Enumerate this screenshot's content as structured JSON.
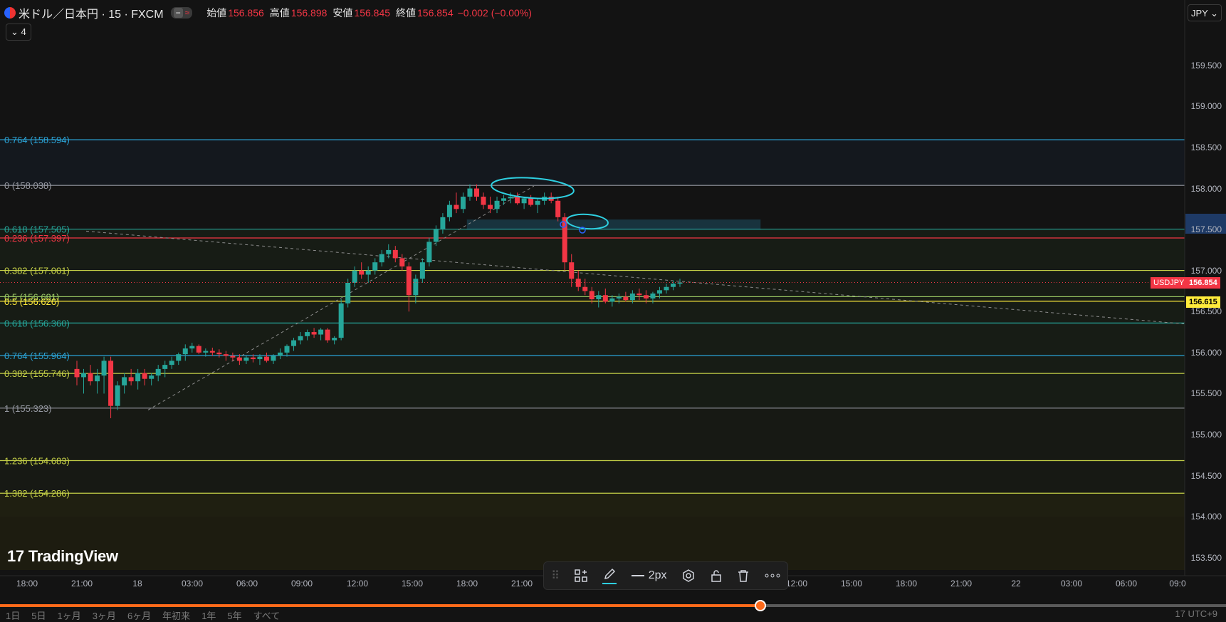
{
  "header": {
    "title": "米ドル／日本円 · 15 · FXCM",
    "ohlc": [
      {
        "label": "始値",
        "value": "156.856"
      },
      {
        "label": "高値",
        "value": "156.898"
      },
      {
        "label": "安値",
        "value": "156.845"
      },
      {
        "label": "終値",
        "value": "156.854"
      },
      {
        "label": "",
        "value": "−0.002 (−0.00%)"
      }
    ],
    "indicator_count": "⌄ 4",
    "currency": "JPY ⌄"
  },
  "price_axis": {
    "ticks": [
      "159.500",
      "159.000",
      "158.500",
      "158.000",
      "157.500",
      "157.000",
      "156.500",
      "156.000",
      "155.500",
      "155.000",
      "154.500",
      "154.000",
      "153.500"
    ],
    "ticks_values": [
      159.5,
      159.0,
      158.5,
      158.0,
      157.5,
      157.0,
      156.5,
      156.0,
      155.5,
      155.0,
      154.5,
      154.0,
      153.5
    ],
    "symbol_tag": "USDJPY",
    "last_price": "156.854",
    "marker_price": "156.615",
    "tag_colors": {
      "last": "#f23645",
      "marker": "#ffeb3b"
    }
  },
  "fib_levels": [
    {
      "label": "0.764 (158.594)",
      "price": 158.594,
      "color": "#2ba3d6"
    },
    {
      "label": "0 (158.038)",
      "price": 158.038,
      "color": "#9598a1"
    },
    {
      "label": "0.618 (157.505)",
      "price": 157.505,
      "color": "#26a69a"
    },
    {
      "label": "0.236 (157.397)",
      "price": 157.397,
      "color": "#f23645"
    },
    {
      "label": "0.382 (157.001)",
      "price": 157.001,
      "color": "#c6d147"
    },
    {
      "label": "0.5 (156.681)",
      "price": 156.681,
      "color": "#9ccc65"
    },
    {
      "label": "0.5 (156.626)",
      "price": 156.626,
      "color": "#ffeb3b"
    },
    {
      "label": "0.618 (156.360)",
      "price": 156.36,
      "color": "#26a69a"
    },
    {
      "label": "0.764 (155.964)",
      "price": 155.964,
      "color": "#2ba3d6"
    },
    {
      "label": "0.382 (155.746)",
      "price": 155.746,
      "color": "#c6d147"
    },
    {
      "label": "1 (155.323)",
      "price": 155.323,
      "color": "#9598a1"
    },
    {
      "label": "1.236 (154.683)",
      "price": 154.683,
      "color": "#c6d147"
    },
    {
      "label": "1.382 (154.286)",
      "price": 154.286,
      "color": "#c6d147"
    }
  ],
  "time_axis": {
    "labels": [
      "18:00",
      "21:00",
      "18",
      "03:00",
      "06:00",
      "09:00",
      "12:00",
      "15:00",
      "18:00",
      "21:00",
      "12:00",
      "15:00",
      "18:00",
      "21:00",
      "22",
      "03:00",
      "06:00",
      "09:0"
    ]
  },
  "chart_data": {
    "type": "candlestick",
    "symbol": "USDJPY",
    "interval": "15",
    "ylim": [
      153.35,
      159.95
    ],
    "up_color": "#26a69a",
    "down_color": "#f23645",
    "candles": [
      [
        155.8,
        155.9,
        155.6,
        155.7
      ],
      [
        155.7,
        155.8,
        155.5,
        155.75
      ],
      [
        155.75,
        155.85,
        155.6,
        155.65
      ],
      [
        155.65,
        155.8,
        155.5,
        155.72
      ],
      [
        155.72,
        155.95,
        155.5,
        155.9
      ],
      [
        155.9,
        155.95,
        155.2,
        155.35
      ],
      [
        155.35,
        155.65,
        155.3,
        155.6
      ],
      [
        155.6,
        155.75,
        155.5,
        155.7
      ],
      [
        155.7,
        155.8,
        155.6,
        155.65
      ],
      [
        155.65,
        155.8,
        155.55,
        155.75
      ],
      [
        155.75,
        155.8,
        155.6,
        155.68
      ],
      [
        155.68,
        155.75,
        155.6,
        155.72
      ],
      [
        155.72,
        155.85,
        155.65,
        155.8
      ],
      [
        155.8,
        155.9,
        155.7,
        155.85
      ],
      [
        155.85,
        155.95,
        155.8,
        155.9
      ],
      [
        155.9,
        156.0,
        155.85,
        155.98
      ],
      [
        155.98,
        156.1,
        155.9,
        156.05
      ],
      [
        156.05,
        156.12,
        156.0,
        156.08
      ],
      [
        156.08,
        156.1,
        155.98,
        156.0
      ],
      [
        156.0,
        156.05,
        155.95,
        156.02
      ],
      [
        156.02,
        156.06,
        155.96,
        156.0
      ],
      [
        156.0,
        156.04,
        155.94,
        155.98
      ],
      [
        155.98,
        156.02,
        155.9,
        155.96
      ],
      [
        155.96,
        156.0,
        155.9,
        155.94
      ],
      [
        155.94,
        155.98,
        155.85,
        155.9
      ],
      [
        155.9,
        155.96,
        155.86,
        155.94
      ],
      [
        155.94,
        155.98,
        155.88,
        155.92
      ],
      [
        155.92,
        155.98,
        155.85,
        155.95
      ],
      [
        155.95,
        156.0,
        155.88,
        155.9
      ],
      [
        155.9,
        155.98,
        155.86,
        155.96
      ],
      [
        155.96,
        156.05,
        155.92,
        156.0
      ],
      [
        156.0,
        156.1,
        155.95,
        156.08
      ],
      [
        156.08,
        156.18,
        156.02,
        156.15
      ],
      [
        156.15,
        156.25,
        156.1,
        156.2
      ],
      [
        156.2,
        156.28,
        156.15,
        156.25
      ],
      [
        156.25,
        156.3,
        156.18,
        156.22
      ],
      [
        156.22,
        156.3,
        156.15,
        156.28
      ],
      [
        156.28,
        156.3,
        156.12,
        156.15
      ],
      [
        156.15,
        156.2,
        156.1,
        156.18
      ],
      [
        156.18,
        156.65,
        156.15,
        156.6
      ],
      [
        156.6,
        156.9,
        156.55,
        156.85
      ],
      [
        156.85,
        157.05,
        156.8,
        157.0
      ],
      [
        157.0,
        157.1,
        156.9,
        156.95
      ],
      [
        156.95,
        157.05,
        156.85,
        157.0
      ],
      [
        157.0,
        157.15,
        156.95,
        157.1
      ],
      [
        157.1,
        157.25,
        157.05,
        157.2
      ],
      [
        157.2,
        157.32,
        157.15,
        157.25
      ],
      [
        157.25,
        157.3,
        157.1,
        157.15
      ],
      [
        157.15,
        157.2,
        157.0,
        157.05
      ],
      [
        157.05,
        157.1,
        156.5,
        156.7
      ],
      [
        156.7,
        156.95,
        156.6,
        156.9
      ],
      [
        156.9,
        157.15,
        156.85,
        157.1
      ],
      [
        157.1,
        157.4,
        157.05,
        157.35
      ],
      [
        157.35,
        157.55,
        157.3,
        157.5
      ],
      [
        157.5,
        157.7,
        157.45,
        157.65
      ],
      [
        157.65,
        157.85,
        157.6,
        157.8
      ],
      [
        157.8,
        157.95,
        157.7,
        157.75
      ],
      [
        157.75,
        157.95,
        157.7,
        157.9
      ],
      [
        157.9,
        158.05,
        157.85,
        158.0
      ],
      [
        158.0,
        158.05,
        157.85,
        157.9
      ],
      [
        157.9,
        157.95,
        157.75,
        157.8
      ],
      [
        157.8,
        157.9,
        157.7,
        157.75
      ],
      [
        157.75,
        157.9,
        157.7,
        157.85
      ],
      [
        157.85,
        157.92,
        157.8,
        157.88
      ],
      [
        157.88,
        157.95,
        157.82,
        157.9
      ],
      [
        157.9,
        157.95,
        157.8,
        157.82
      ],
      [
        157.82,
        157.9,
        157.75,
        157.88
      ],
      [
        157.88,
        157.92,
        157.78,
        157.8
      ],
      [
        157.8,
        157.88,
        157.7,
        157.85
      ],
      [
        157.85,
        157.95,
        157.8,
        157.9
      ],
      [
        157.9,
        157.95,
        157.82,
        157.85
      ],
      [
        157.85,
        157.9,
        157.6,
        157.65
      ],
      [
        157.65,
        157.7,
        157.0,
        157.1
      ],
      [
        157.1,
        157.2,
        156.8,
        156.9
      ],
      [
        156.9,
        157.0,
        156.75,
        156.8
      ],
      [
        156.8,
        156.9,
        156.7,
        156.75
      ],
      [
        156.75,
        156.8,
        156.6,
        156.65
      ],
      [
        156.65,
        156.75,
        156.55,
        156.7
      ],
      [
        156.7,
        156.78,
        156.6,
        156.62
      ],
      [
        156.62,
        156.7,
        156.56,
        156.66
      ],
      [
        156.66,
        156.72,
        156.6,
        156.68
      ],
      [
        156.68,
        156.74,
        156.62,
        156.64
      ],
      [
        156.64,
        156.76,
        156.6,
        156.72
      ],
      [
        156.72,
        156.78,
        156.64,
        156.7
      ],
      [
        156.7,
        156.76,
        156.6,
        156.66
      ],
      [
        156.66,
        156.74,
        156.6,
        156.72
      ],
      [
        156.72,
        156.8,
        156.66,
        156.76
      ],
      [
        156.76,
        156.84,
        156.72,
        156.8
      ],
      [
        156.8,
        156.88,
        156.76,
        156.84
      ],
      [
        156.84,
        156.9,
        156.8,
        156.854
      ]
    ],
    "x_first": 108,
    "x_last": 955,
    "zone_box": {
      "price_top": 157.62,
      "price_bottom": 157.5,
      "x1": 656,
      "x2": 1068
    },
    "trendline_dashed": [
      {
        "x1": 121,
        "p1": 157.48,
        "x2": 1663,
        "p2": 156.35
      },
      {
        "x1": 208,
        "p1": 155.3,
        "x2": 750,
        "p2": 158.03
      }
    ],
    "ellipses": [
      {
        "cx": 748,
        "cy": 264,
        "rx": 58,
        "ry": 14
      },
      {
        "cx": 825,
        "cy": 311,
        "rx": 29,
        "ry": 10
      }
    ]
  },
  "tradingview_logo": "TradingView",
  "toolbar": {
    "drag_handle": "⠿",
    "stroke_width": "2px"
  },
  "bottom": {
    "ranges": [
      "1日",
      "5日",
      "1ヶ月",
      "3ヶ月",
      "6ヶ月",
      "年初来",
      "1年",
      "5年",
      "すべて"
    ],
    "timezone": "17 UTC+9",
    "progress": 0.62
  }
}
